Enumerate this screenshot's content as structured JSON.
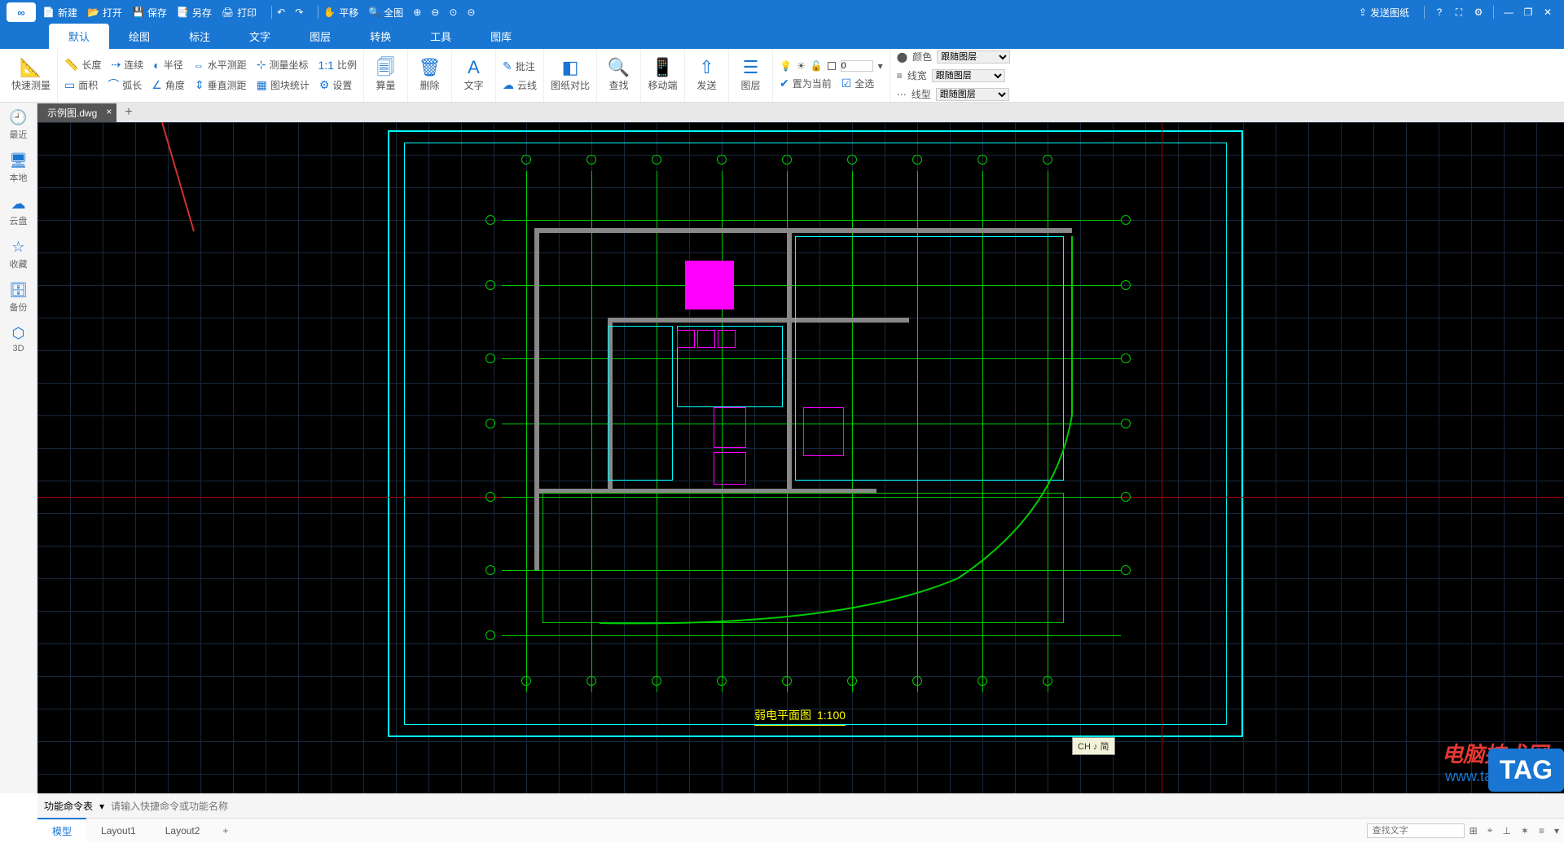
{
  "titlebar": {
    "items": [
      "新建",
      "打开",
      "保存",
      "另存",
      "打印"
    ],
    "pan": "平移",
    "fit": "全图",
    "send": "发送图纸"
  },
  "menutabs": [
    "默认",
    "绘图",
    "标注",
    "文字",
    "图层",
    "转换",
    "工具",
    "图库"
  ],
  "ribbon": {
    "quickmeasure": "快速测量",
    "row1": [
      "长度",
      "连续",
      "半径",
      "水平测距",
      "测量坐标",
      "比例"
    ],
    "row2": [
      "面积",
      "弧长",
      "角度",
      "垂直测距",
      "图块统计",
      "设置"
    ],
    "calc": "算量",
    "delete": "删除",
    "text": "文字",
    "annot_row1": "批注",
    "annot_row2": "云线",
    "compare": "图纸对比",
    "find": "查找",
    "mobile": "移动端",
    "send": "发送",
    "layer": "图层",
    "layer_row1": "置为当前",
    "layer_row2": "全选",
    "layer_num": "0",
    "prop_color": "颜色",
    "prop_lw": "线宽",
    "prop_lt": "线型",
    "prop_follow": "跟随图层"
  },
  "leftbar": [
    "最近",
    "本地",
    "云盘",
    "收藏",
    "备份",
    "3D"
  ],
  "filetab": "示例图.dwg",
  "plan_title": "弱电平面图",
  "plan_scale": "1:100",
  "tooltip": "CH ♪ 简",
  "cmdbar": {
    "label": "功能命令表",
    "placeholder": "请输入快捷命令或功能名称"
  },
  "layouts": [
    "模型",
    "Layout1",
    "Layout2"
  ],
  "search_placeholder": "查找文字",
  "watermark": {
    "line1": "电脑技术网",
    "line2": "www.tagxp.com",
    "tag": "TAG"
  }
}
